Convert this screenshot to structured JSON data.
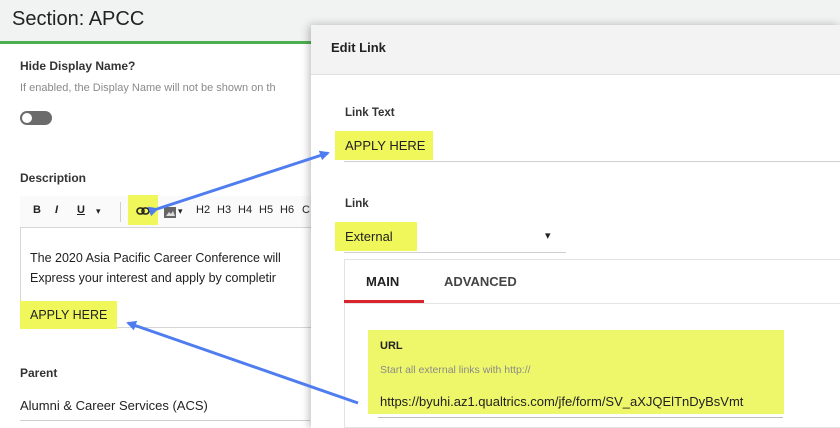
{
  "section": {
    "title": "Section: APCC",
    "hide_display_name_label": "Hide Display Name?",
    "hide_display_name_hint": "If enabled, the Display Name will not be shown on th",
    "description_label": "Description",
    "parent_label": "Parent",
    "parent_value": "Alumni & Career Services (ACS)"
  },
  "editor": {
    "toolbar": {
      "bold": "B",
      "italic": "I",
      "underline": "U",
      "dropdown": "▾",
      "image_dropdown": "▾",
      "h2": "H2",
      "h3": "H3",
      "h4": "H4",
      "h5": "H5",
      "h6": "H6",
      "overflow": "C"
    },
    "line1": "The 2020 Asia Pacific Career Conference will",
    "line2": "Express your interest and apply by completir",
    "link_text": "APPLY HERE"
  },
  "modal": {
    "title": "Edit Link",
    "link_text_label": "Link Text",
    "link_text_value": "APPLY HERE",
    "link_label": "Link",
    "link_type_value": "External",
    "link_type_caret": "▾",
    "tabs": [
      {
        "label": "MAIN",
        "active": true
      },
      {
        "label": "ADVANCED",
        "active": false
      }
    ],
    "url_label": "URL",
    "url_hint": "Start all external links with http://",
    "url_value": "https://byuhi.az1.qualtrics.com/jfe/form/SV_aXJQElTnDyBsVmt"
  },
  "colors": {
    "highlight": "#f0f75a",
    "arrow": "#4f7df0",
    "accent_green": "#4caf50",
    "active_tab": "#d9232d"
  },
  "icons": {
    "link": "link-icon",
    "image": "image-icon",
    "caret": "chevron-down-icon"
  }
}
